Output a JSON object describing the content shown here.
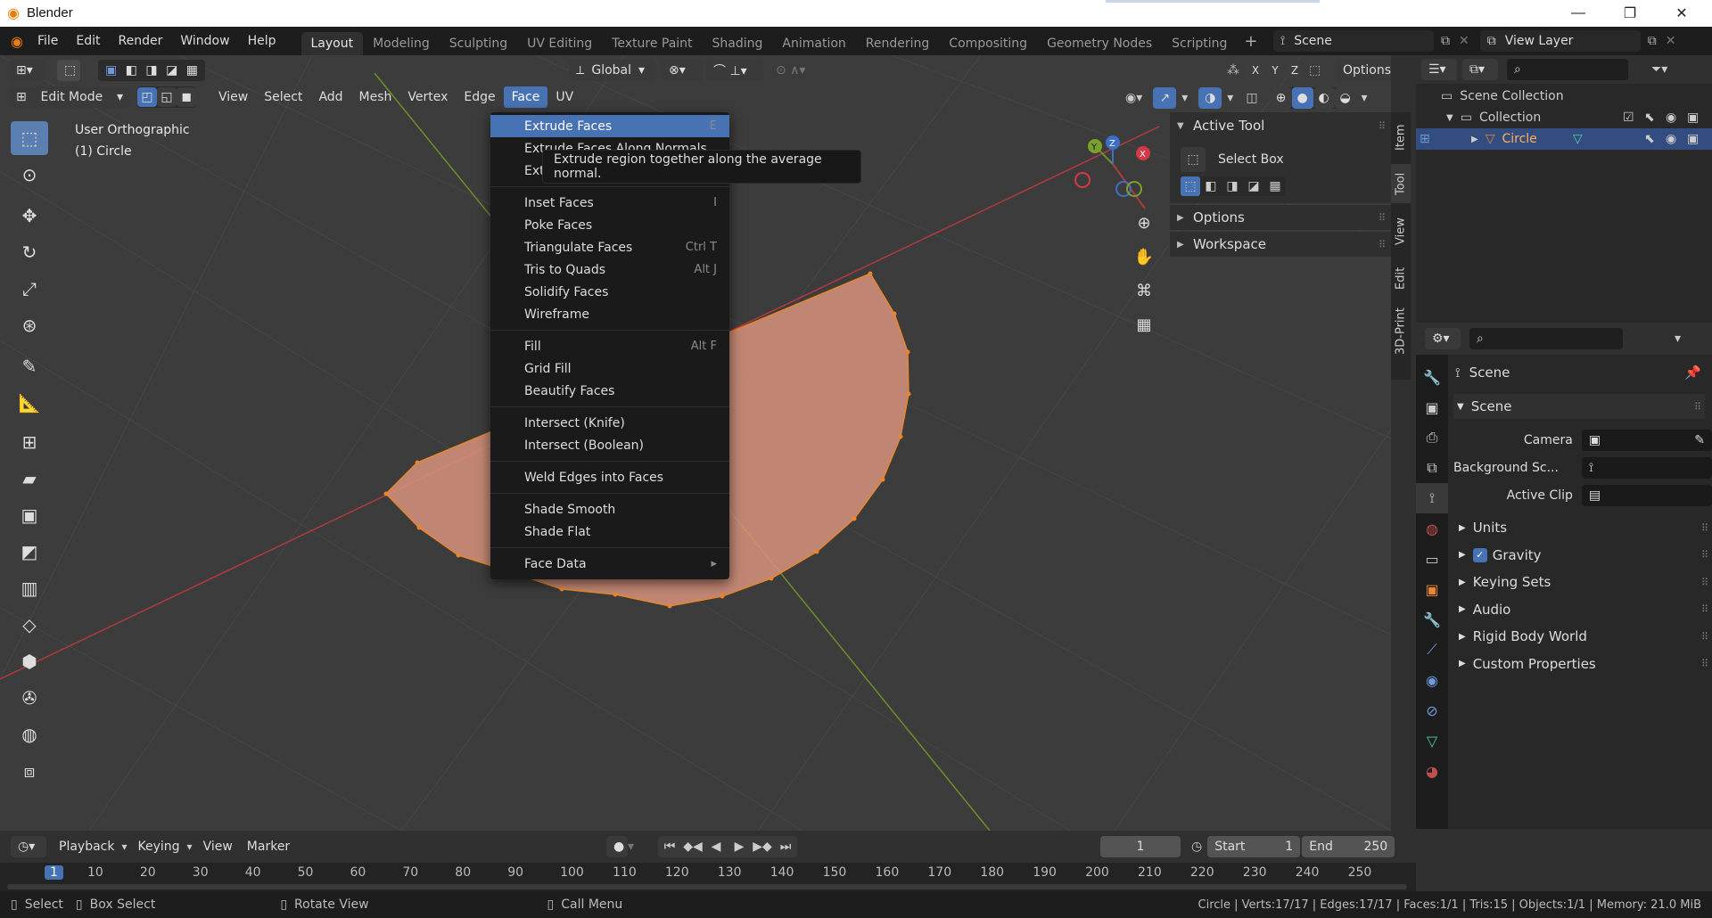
{
  "window": {
    "title": "Blender",
    "minimize": "—",
    "restore": "❐",
    "close": "✕"
  },
  "topmenu": [
    "File",
    "Edit",
    "Render",
    "Window",
    "Help"
  ],
  "workspaces": [
    "Layout",
    "Modeling",
    "Sculpting",
    "UV Editing",
    "Texture Paint",
    "Shading",
    "Animation",
    "Rendering",
    "Compositing",
    "Geometry Nodes",
    "Scripting"
  ],
  "workspace_add": "+",
  "scene": {
    "name": "Scene",
    "view_layer": "View Layer"
  },
  "tool_header": {
    "orientation": "Global",
    "options": "Options",
    "axes": [
      "X",
      "Y",
      "Z"
    ]
  },
  "view_header": {
    "mode": "Edit Mode",
    "menus": [
      "View",
      "Select",
      "Add",
      "Mesh",
      "Vertex",
      "Edge",
      "Face",
      "UV"
    ]
  },
  "viewport": {
    "view_name": "User Orthographic",
    "object_name": "(1) Circle"
  },
  "gizmo": {
    "x": "X",
    "y": "Y",
    "z": "Z"
  },
  "face_menu": {
    "items": [
      {
        "label": "Extrude Faces",
        "shortcut": "E",
        "highlight": true
      },
      {
        "label": "Extrude Faces Along Normals",
        "shortcut": ""
      },
      {
        "label": "Extrude Individual Faces",
        "shortcut": ""
      },
      {
        "sep": true
      },
      {
        "label": "Inset Faces",
        "shortcut": "I"
      },
      {
        "label": "Poke Faces",
        "shortcut": ""
      },
      {
        "label": "Triangulate Faces",
        "shortcut": "Ctrl T"
      },
      {
        "label": "Tris to Quads",
        "shortcut": "Alt J"
      },
      {
        "label": "Solidify Faces",
        "shortcut": ""
      },
      {
        "label": "Wireframe",
        "shortcut": ""
      },
      {
        "sep": true
      },
      {
        "label": "Fill",
        "shortcut": "Alt F"
      },
      {
        "label": "Grid Fill",
        "shortcut": ""
      },
      {
        "label": "Beautify Faces",
        "shortcut": ""
      },
      {
        "sep": true
      },
      {
        "label": "Intersect (Knife)",
        "shortcut": ""
      },
      {
        "label": "Intersect (Boolean)",
        "shortcut": ""
      },
      {
        "sep": true
      },
      {
        "label": "Weld Edges into Faces",
        "shortcut": ""
      },
      {
        "sep": true
      },
      {
        "label": "Shade Smooth",
        "shortcut": ""
      },
      {
        "label": "Shade Flat",
        "shortcut": ""
      },
      {
        "sep": true
      },
      {
        "label": "Face Data",
        "shortcut": "▸"
      }
    ]
  },
  "tooltip": "Extrude region together along the average normal.",
  "npanel": {
    "active_tool": "Active Tool",
    "tool_name": "Select Box",
    "options": "Options",
    "workspace": "Workspace",
    "tabs": [
      "Item",
      "Tool",
      "View",
      "Edit",
      "3D-Print"
    ]
  },
  "outliner": {
    "scene_collection": "Scene Collection",
    "collection": "Collection",
    "object": "Circle"
  },
  "properties": {
    "header": "Scene",
    "section": "Scene",
    "camera_label": "Camera",
    "background_label": "Background Sc...",
    "active_clip_label": "Active Clip",
    "subpanels": [
      "Units",
      "Gravity",
      "Keying Sets",
      "Audio",
      "Rigid Body World",
      "Custom Properties"
    ]
  },
  "timeline": {
    "menus": [
      "Playback",
      "Keying",
      "View",
      "Marker"
    ],
    "current_frame": "1",
    "start_label": "Start",
    "start": "1",
    "end_label": "End",
    "end": "250",
    "ruler": [
      "1",
      "10",
      "20",
      "30",
      "40",
      "50",
      "60",
      "70",
      "80",
      "90",
      "100",
      "110",
      "120",
      "130",
      "140",
      "150",
      "160",
      "170",
      "180",
      "190",
      "200",
      "210",
      "220",
      "230",
      "240",
      "250"
    ]
  },
  "statusbar": {
    "select": "Select",
    "box_select": "Box Select",
    "rotate_view": "Rotate View",
    "call_menu": "Call Menu",
    "stats": "Circle | Verts:17/17 | Edges:17/17 | Faces:1/1 | Tris:15 | Objects:1/1 | Memory: 21.0 MiB"
  },
  "colors": {
    "accent": "#4772b3",
    "face_fill": "#d8937c",
    "edge": "#e8862e",
    "x_axis": "#c8343c",
    "y_axis": "#7aa12c"
  }
}
